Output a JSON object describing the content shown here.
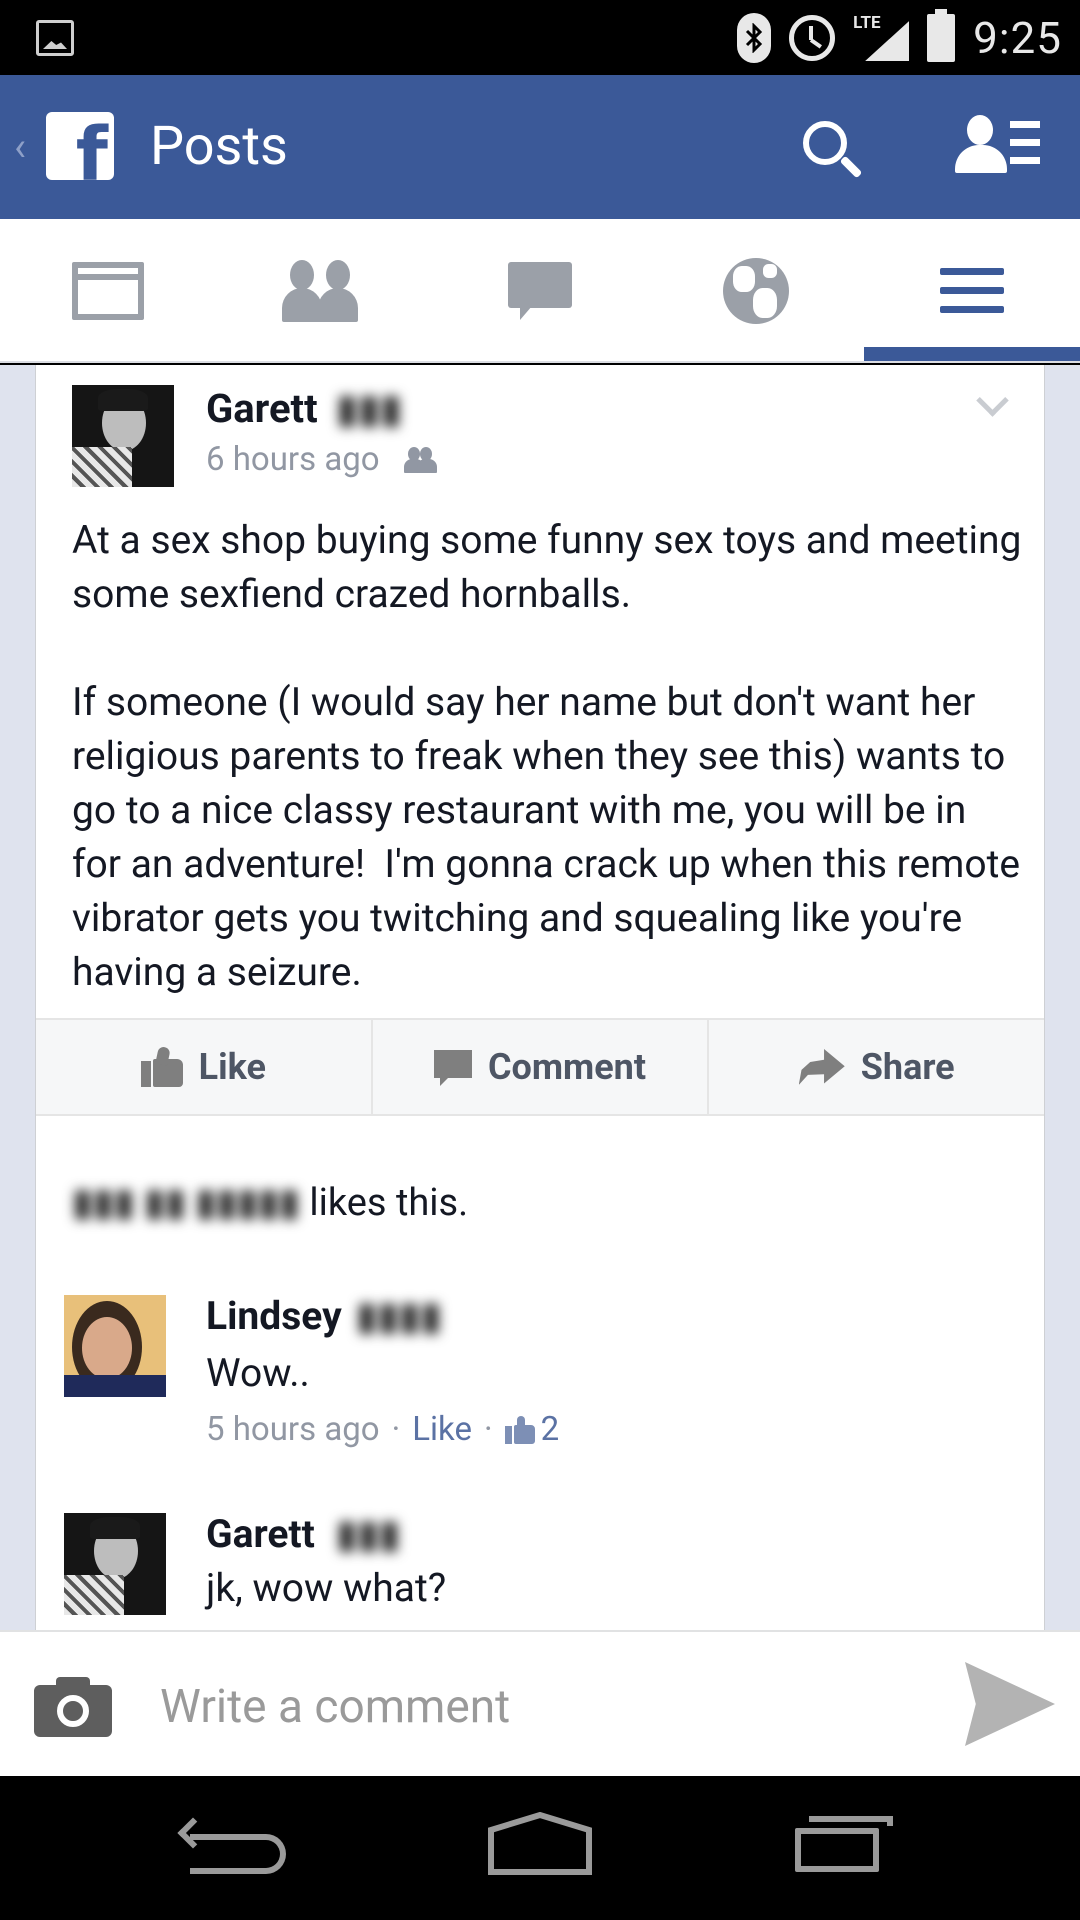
{
  "status_bar": {
    "time": "9:25",
    "network": "LTE",
    "icons": [
      "image-icon",
      "bluetooth-icon",
      "alarm-icon",
      "lte-signal-icon",
      "battery-icon"
    ]
  },
  "header": {
    "title": "Posts",
    "logo_letter": "f",
    "background": "#3b5998"
  },
  "tabs": [
    {
      "name": "news-feed",
      "icon": "news-feed-icon",
      "active": false
    },
    {
      "name": "friend-requests",
      "icon": "friends-icon",
      "active": false
    },
    {
      "name": "messages",
      "icon": "messages-icon",
      "active": false
    },
    {
      "name": "notifications",
      "icon": "globe-icon",
      "active": false
    },
    {
      "name": "more",
      "icon": "menu-icon",
      "active": true
    }
  ],
  "post": {
    "author": "Garett",
    "time": "6 hours ago",
    "text": "At a sex shop buying some funny sex toys and meeting some sexfiend crazed hornballs.\n\nIf someone (I would say her name but don't want her religious parents to freak when they see this) wants to go to a nice classy restaurant with me, you will be in for an adventure!  I'm gonna crack up when this remote vibrator gets you twitching and squealing like you're having a seizure.",
    "actions": {
      "like": "Like",
      "comment": "Comment",
      "share": "Share"
    },
    "likes_line": "likes this."
  },
  "comments": [
    {
      "author": "Lindsey",
      "text": "Wow..",
      "time": "5 hours ago",
      "like_label": "Like",
      "like_count": "2",
      "separator": "·"
    },
    {
      "author": "Garett",
      "text": "jk, wow what?"
    }
  ],
  "composer": {
    "placeholder": "Write a comment"
  }
}
